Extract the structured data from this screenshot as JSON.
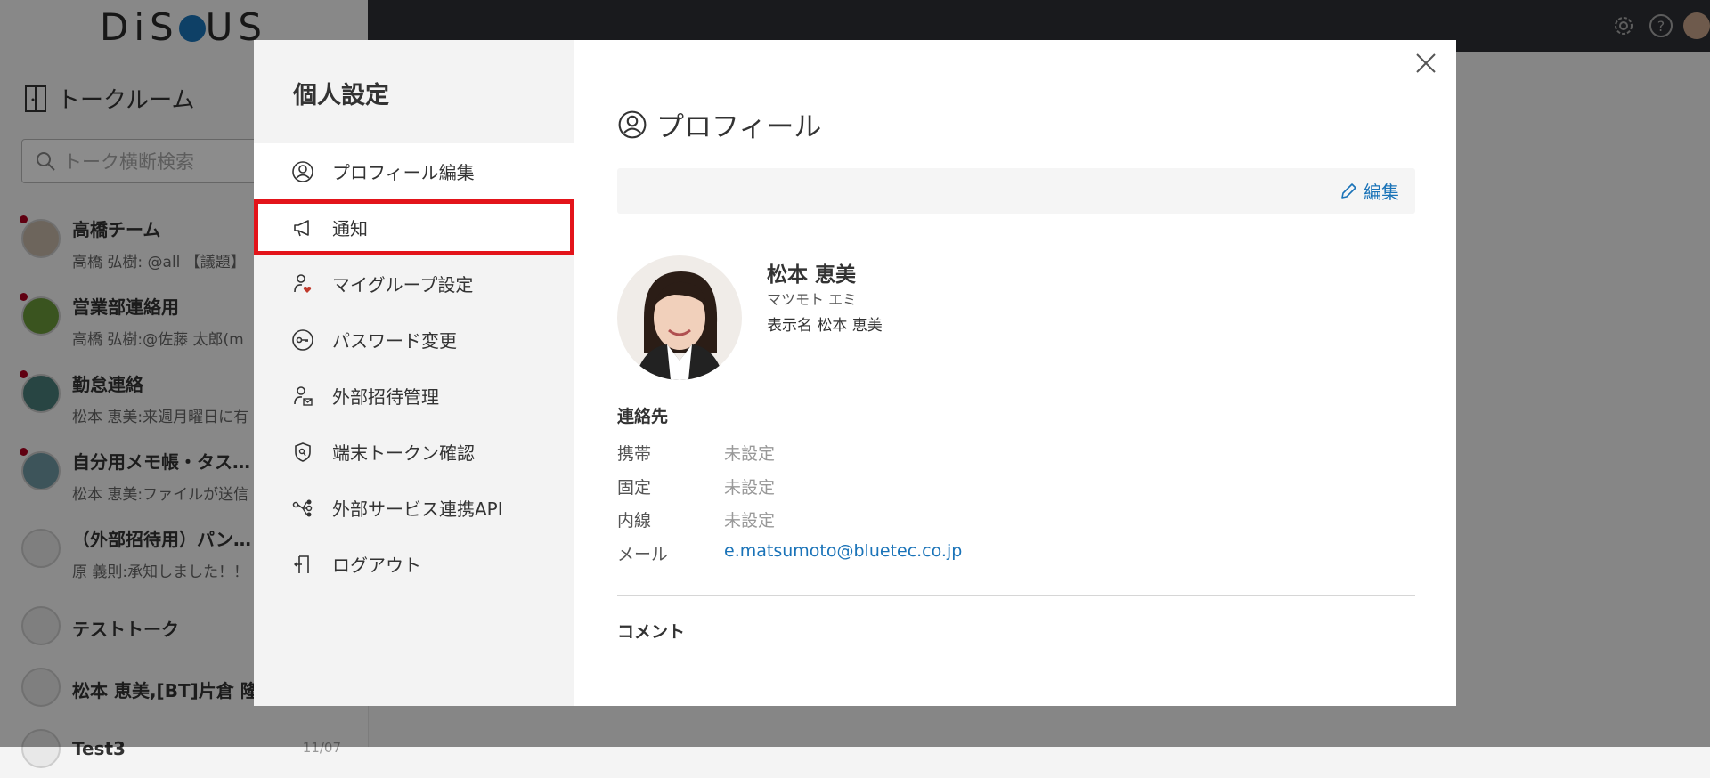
{
  "app": {
    "logo": "DiSCUS",
    "sidebar_title": "トークルーム",
    "search_placeholder": "トーク横断検索",
    "rooms": [
      {
        "name": "高橋チーム",
        "preview": "高橋 弘樹: @all 【議題】",
        "unread": true
      },
      {
        "name": "営業部連絡用",
        "preview": "高橋 弘樹:@佐藤 太郎(m",
        "unread": true
      },
      {
        "name": "勤怠連絡",
        "preview": "松本 恵美:来週月曜日に有",
        "unread": true
      },
      {
        "name": "自分用メモ帳・タス…",
        "preview": "松本 恵美:ファイルが送信",
        "unread": true
      },
      {
        "name": "（外部招待用）パン…",
        "preview": "原 義則:承知しました！！",
        "unread": false
      },
      {
        "name": "テストトーク",
        "preview": "",
        "unread": false
      },
      {
        "name": "松本 恵美,[BT]片倉 隆",
        "preview": "",
        "unread": false
      },
      {
        "name": "Test3",
        "preview": "",
        "date": "11/07",
        "unread": false
      }
    ]
  },
  "settings": {
    "title": "個人設定",
    "menu": [
      {
        "label": "プロフィール編集",
        "icon": "user-circle-icon"
      },
      {
        "label": "通知",
        "icon": "megaphone-icon"
      },
      {
        "label": "マイグループ設定",
        "icon": "user-heart-icon"
      },
      {
        "label": "パスワード変更",
        "icon": "key-icon"
      },
      {
        "label": "外部招待管理",
        "icon": "user-mail-icon"
      },
      {
        "label": "端末トークン確認",
        "icon": "shield-icon"
      },
      {
        "label": "外部サービス連携API",
        "icon": "api-nodes-icon"
      },
      {
        "label": "ログアウト",
        "icon": "logout-icon"
      }
    ]
  },
  "profile": {
    "heading": "プロフィール",
    "edit_label": "編集",
    "name": "松本 恵美",
    "kana": "マツモト エミ",
    "display_name": "表示名 松本 恵美",
    "contact_title": "連絡先",
    "contacts": [
      {
        "key": "携帯",
        "value": "未設定"
      },
      {
        "key": "固定",
        "value": "未設定"
      },
      {
        "key": "内線",
        "value": "未設定"
      },
      {
        "key": "メール",
        "value": "e.matsumoto@bluetec.co.jp"
      }
    ],
    "comment_title": "コメント"
  },
  "colors": {
    "accent": "#1a73b8",
    "highlight_border": "#e3141a",
    "topbar": "#2f3136"
  }
}
